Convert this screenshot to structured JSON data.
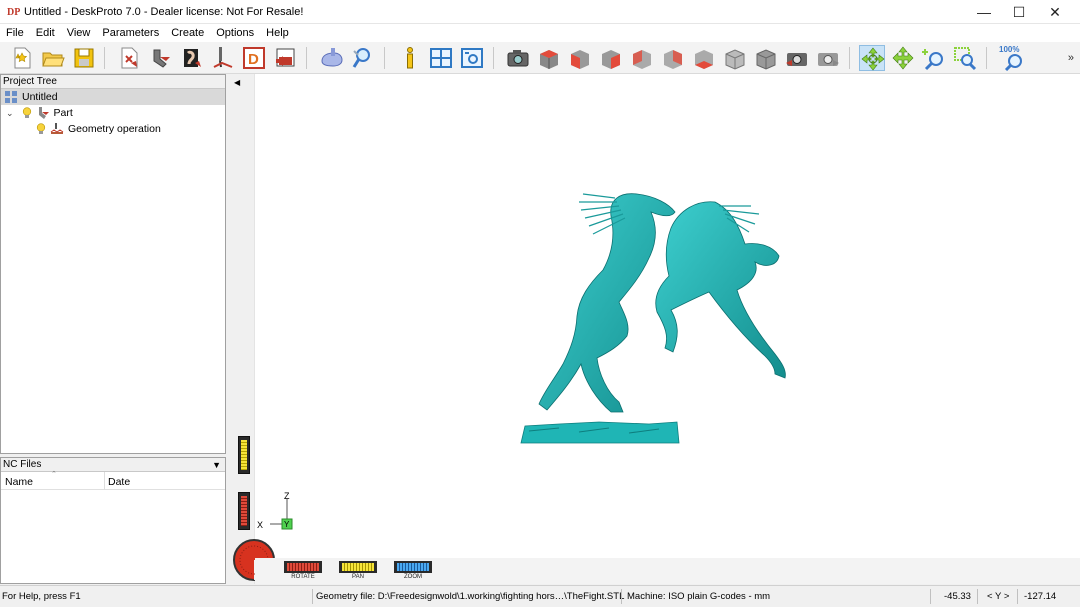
{
  "window": {
    "title": "Untitled - DeskProto 7.0 - Dealer license: Not For Resale!",
    "icon_text": "DP",
    "minimize_glyph": "—",
    "maximize_glyph": "☐",
    "close_glyph": "✕"
  },
  "menu": {
    "items": [
      "File",
      "Edit",
      "View",
      "Parameters",
      "Create",
      "Options",
      "Help"
    ]
  },
  "toolbar": {
    "zoom_badge": "100%",
    "more_glyph": "»"
  },
  "project_tree": {
    "header": "Project Tree",
    "root": "Untitled",
    "part": "Part",
    "operation": "Geometry operation"
  },
  "nc_files": {
    "header": "NC Files",
    "col_name": "Name",
    "col_date": "Date"
  },
  "viewport": {
    "model_color": "#1fb5b5",
    "axis_z": "Z",
    "axis_x": "X",
    "axis_y": "Y",
    "dial_rotate": "ROTATE",
    "dial_pan": "PAN",
    "dial_zoom": "ZOOM"
  },
  "status": {
    "help": "For Help, press F1",
    "geometry_file": "Geometry file: D:\\Freedesignwold\\1.working\\fighting hors…\\TheFight.STL",
    "machine": "Machine: ISO plain G-codes - mm",
    "coord_left": "-45.33",
    "axis_indicator": "< Y >",
    "coord_right": "-127.14"
  }
}
